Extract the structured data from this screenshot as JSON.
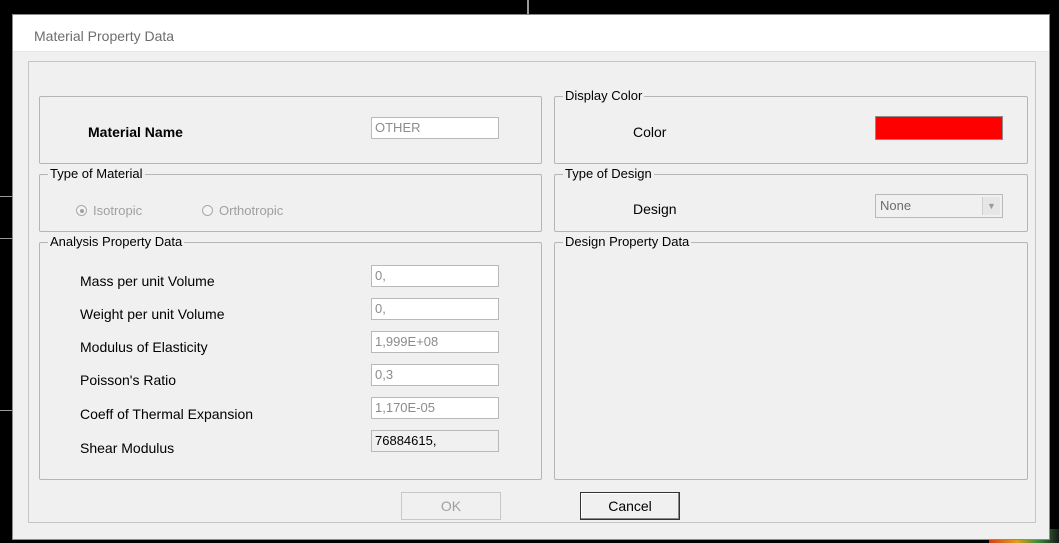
{
  "dialog": {
    "title": "Material Property Data",
    "material_name": {
      "label": "Material Name",
      "value": "OTHER"
    },
    "display_color": {
      "legend": "Display Color",
      "label": "Color",
      "swatch_color": "#ff0000"
    },
    "type_of_material": {
      "legend": "Type of Material",
      "options": [
        "Isotropic",
        "Orthotropic"
      ],
      "selected": "Isotropic"
    },
    "type_of_design": {
      "legend": "Type of Design",
      "label": "Design",
      "value": "None"
    },
    "analysis": {
      "legend": "Analysis Property Data",
      "rows": [
        {
          "label": "Mass per unit Volume",
          "value": "0,"
        },
        {
          "label": "Weight per unit Volume",
          "value": "0,"
        },
        {
          "label": "Modulus of Elasticity",
          "value": "1,999E+08"
        },
        {
          "label": "Poisson's Ratio",
          "value": "0,3"
        },
        {
          "label": "Coeff of Thermal Expansion",
          "value": "1,170E-05"
        },
        {
          "label": "Shear Modulus",
          "value": "76884615,"
        }
      ]
    },
    "design_property": {
      "legend": "Design Property Data"
    },
    "buttons": {
      "ok": "OK",
      "cancel": "Cancel"
    }
  }
}
